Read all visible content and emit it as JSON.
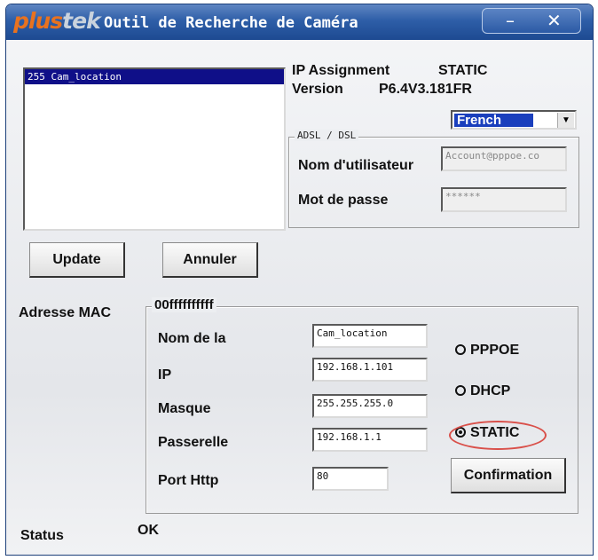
{
  "window": {
    "brand_part1": "plus",
    "brand_part2": "tek",
    "title": "Outil de Recherche de Caméra",
    "minimize": "–",
    "close": "✕"
  },
  "camera_list": [
    "255 Cam_location"
  ],
  "info": {
    "ip_assignment_label": "IP Assignment",
    "ip_assignment_value": "STATIC",
    "version_label": "Version",
    "version_value": "P6.4V3.181FR"
  },
  "language": {
    "selected": "French",
    "arrow": "▼"
  },
  "adsl": {
    "group_title": "ADSL / DSL",
    "username_label": "Nom d'utilisateur",
    "username_value": "Account@pppoe.co",
    "password_label": "Mot de passe",
    "password_value": "******"
  },
  "buttons": {
    "update": "Update",
    "cancel": "Annuler",
    "confirm": "Confirmation"
  },
  "network": {
    "mac_label": "Adresse MAC",
    "mac_value": "00ffffffffff",
    "name_label": "Nom de la",
    "name_value": "Cam_location",
    "ip_label": "IP",
    "ip_value": "192.168.1.101",
    "mask_label": "Masque",
    "mask_value": "255.255.255.0",
    "gateway_label": "Passerelle",
    "gateway_value": "192.168.1.1",
    "port_label": "Port Http",
    "port_value": "80"
  },
  "modes": {
    "pppoe": "PPPOE",
    "dhcp": "DHCP",
    "static": "STATIC",
    "selected": "static"
  },
  "status": {
    "label": "Status",
    "value": "OK"
  },
  "colors": {
    "titlebar": "#2e5ea8",
    "selection": "#0f0f88",
    "highlight_ring": "#d9504a",
    "brand_orange": "#e8721f"
  }
}
